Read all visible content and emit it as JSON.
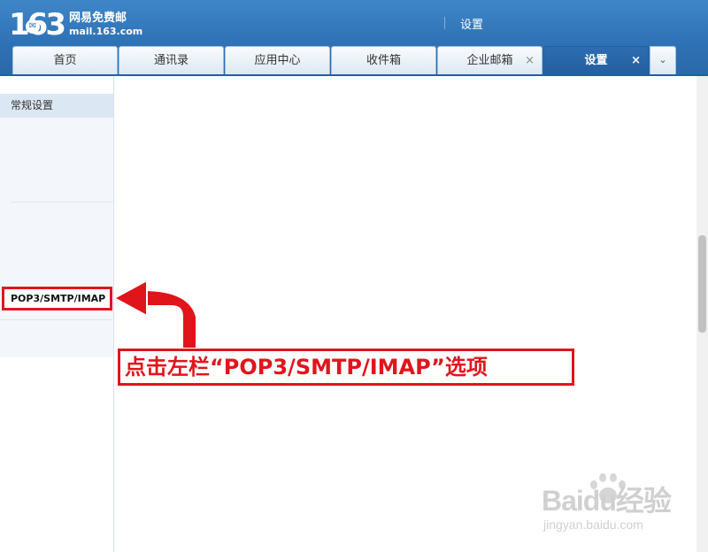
{
  "logo": {
    "number": "163",
    "name": "网易免费邮",
    "domain": "mail.163.com"
  },
  "header": {
    "title": "设置"
  },
  "tabs": [
    {
      "label": "首页",
      "closable": false,
      "active": false
    },
    {
      "label": "通讯录",
      "closable": false,
      "active": false
    },
    {
      "label": "应用中心",
      "closable": false,
      "active": false
    },
    {
      "label": "收件箱",
      "closable": false,
      "active": false
    },
    {
      "label": "企业邮箱",
      "closable": true,
      "active": false
    },
    {
      "label": "设置",
      "closable": true,
      "active": true
    }
  ],
  "tab_close_glyph": "×",
  "tab_more_glyph": "⌄",
  "sidebar": {
    "heading": "常规设置",
    "items": [
      {
        "label": "POP3/SMTP/IMAP"
      }
    ]
  },
  "annotation": {
    "callout": "点击左栏“POP3/SMTP/IMAP”选项",
    "color": "#e0151c"
  },
  "watermark": {
    "brand": "Baidu经验",
    "url": "jingyan.baidu.com"
  },
  "colors": {
    "header_blue": "#2f72b6",
    "active_tab": "#245f9f",
    "sidebar_heading_bg": "#dbe7f3"
  },
  "icons": {
    "tab_close": "close-icon",
    "tab_more": "chevron-down-icon",
    "logo_badge": "mail-badge-icon",
    "watermark": "paw-icon"
  }
}
